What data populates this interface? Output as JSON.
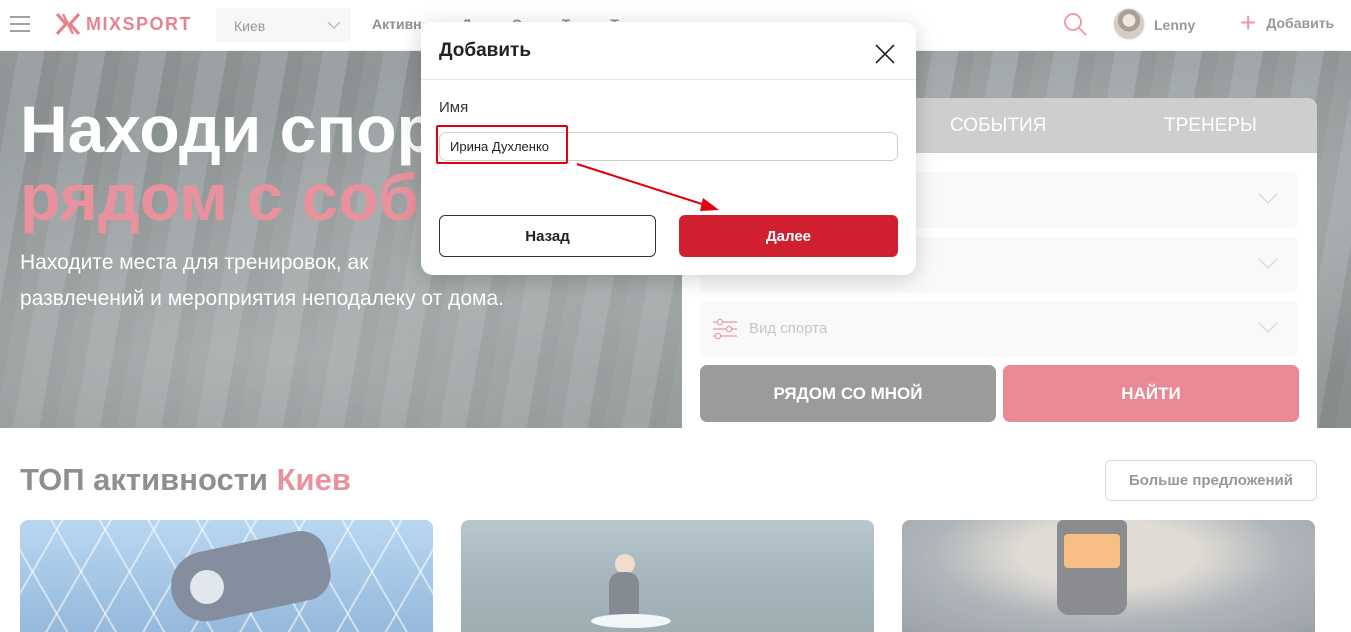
{
  "header": {
    "logo": "MIXSPORT",
    "city": "Киев",
    "nav": [
      "Активн",
      "Д",
      "С",
      "Т",
      "Т"
    ],
    "user_name": "Lenny",
    "add_label": "Добавить"
  },
  "hero": {
    "title_line1": "Находи спор",
    "title_line2": "рядом с соб",
    "subtitle_line1": "Находите места для тренировок, ак",
    "subtitle_line2": "развлечений и мероприятия неподалеку от дома."
  },
  "search_panel": {
    "tab_events": "СОБЫТИЯ",
    "tab_trainers": "ТРЕНЕРЫ",
    "sport_placeholder": "Вид спорта",
    "near_me_button": "РЯДОМ СО МНОЙ",
    "find_button": "НАЙТИ"
  },
  "top_section": {
    "title_prefix": "ТОП активности",
    "title_city": "Киев",
    "more_button": "Больше предложений"
  },
  "modal": {
    "title": "Добавить",
    "name_label": "Имя",
    "name_value": "Ирина Духленко",
    "back_button": "Назад",
    "next_button": "Далее"
  },
  "colors": {
    "brand_red": "#d01f2e",
    "accent_pink": "#d8384e",
    "annotation_red": "#e0000f"
  }
}
